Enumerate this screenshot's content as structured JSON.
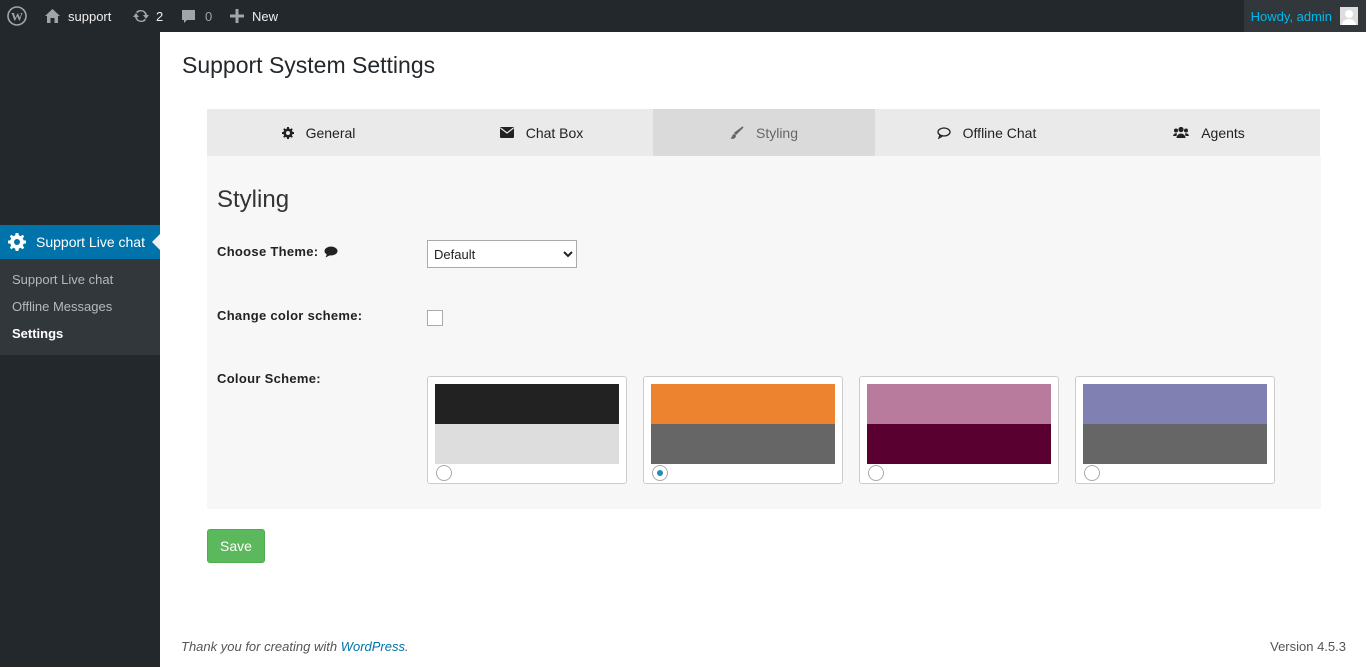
{
  "admin_bar": {
    "site_name": "support",
    "updates_count": "2",
    "comments_count": "0",
    "new_label": "New",
    "howdy": "Howdy, admin"
  },
  "sidebar": {
    "current_menu": "Support Live chat",
    "submenu": [
      {
        "label": "Support Live chat"
      },
      {
        "label": "Offline Messages"
      },
      {
        "label": "Settings"
      }
    ]
  },
  "page": {
    "title": "Support System Settings"
  },
  "tabs": [
    {
      "label": "General",
      "icon": "gear-icon"
    },
    {
      "label": "Chat Box",
      "icon": "envelope-icon"
    },
    {
      "label": "Styling",
      "icon": "paintbrush-icon"
    },
    {
      "label": "Offline Chat",
      "icon": "comment-icon"
    },
    {
      "label": "Agents",
      "icon": "users-icon"
    }
  ],
  "panel": {
    "title": "Styling",
    "choose_theme_label": "Choose Theme:",
    "theme_value": "Default",
    "theme_options": [
      "Default"
    ],
    "change_color_label": "Change color scheme:",
    "change_color_checked": false,
    "colour_scheme_label": "Colour Scheme:",
    "schemes": [
      {
        "top": "#222222",
        "bottom": "#dddddd",
        "selected": false
      },
      {
        "top": "#ed832f",
        "bottom": "#666666",
        "selected": true
      },
      {
        "top": "#b97b9d",
        "bottom": "#5a0031",
        "selected": false
      },
      {
        "top": "#8180b3",
        "bottom": "#666666",
        "selected": false
      }
    ]
  },
  "save_label": "Save",
  "footer": {
    "thanks_prefix": "Thank you for creating with ",
    "thanks_link": "WordPress",
    "thanks_suffix": ".",
    "version": "Version 4.5.3"
  },
  "colors": {
    "admin_dark": "#23282d",
    "accent": "#0073aa",
    "save_green": "#5cb85c"
  }
}
